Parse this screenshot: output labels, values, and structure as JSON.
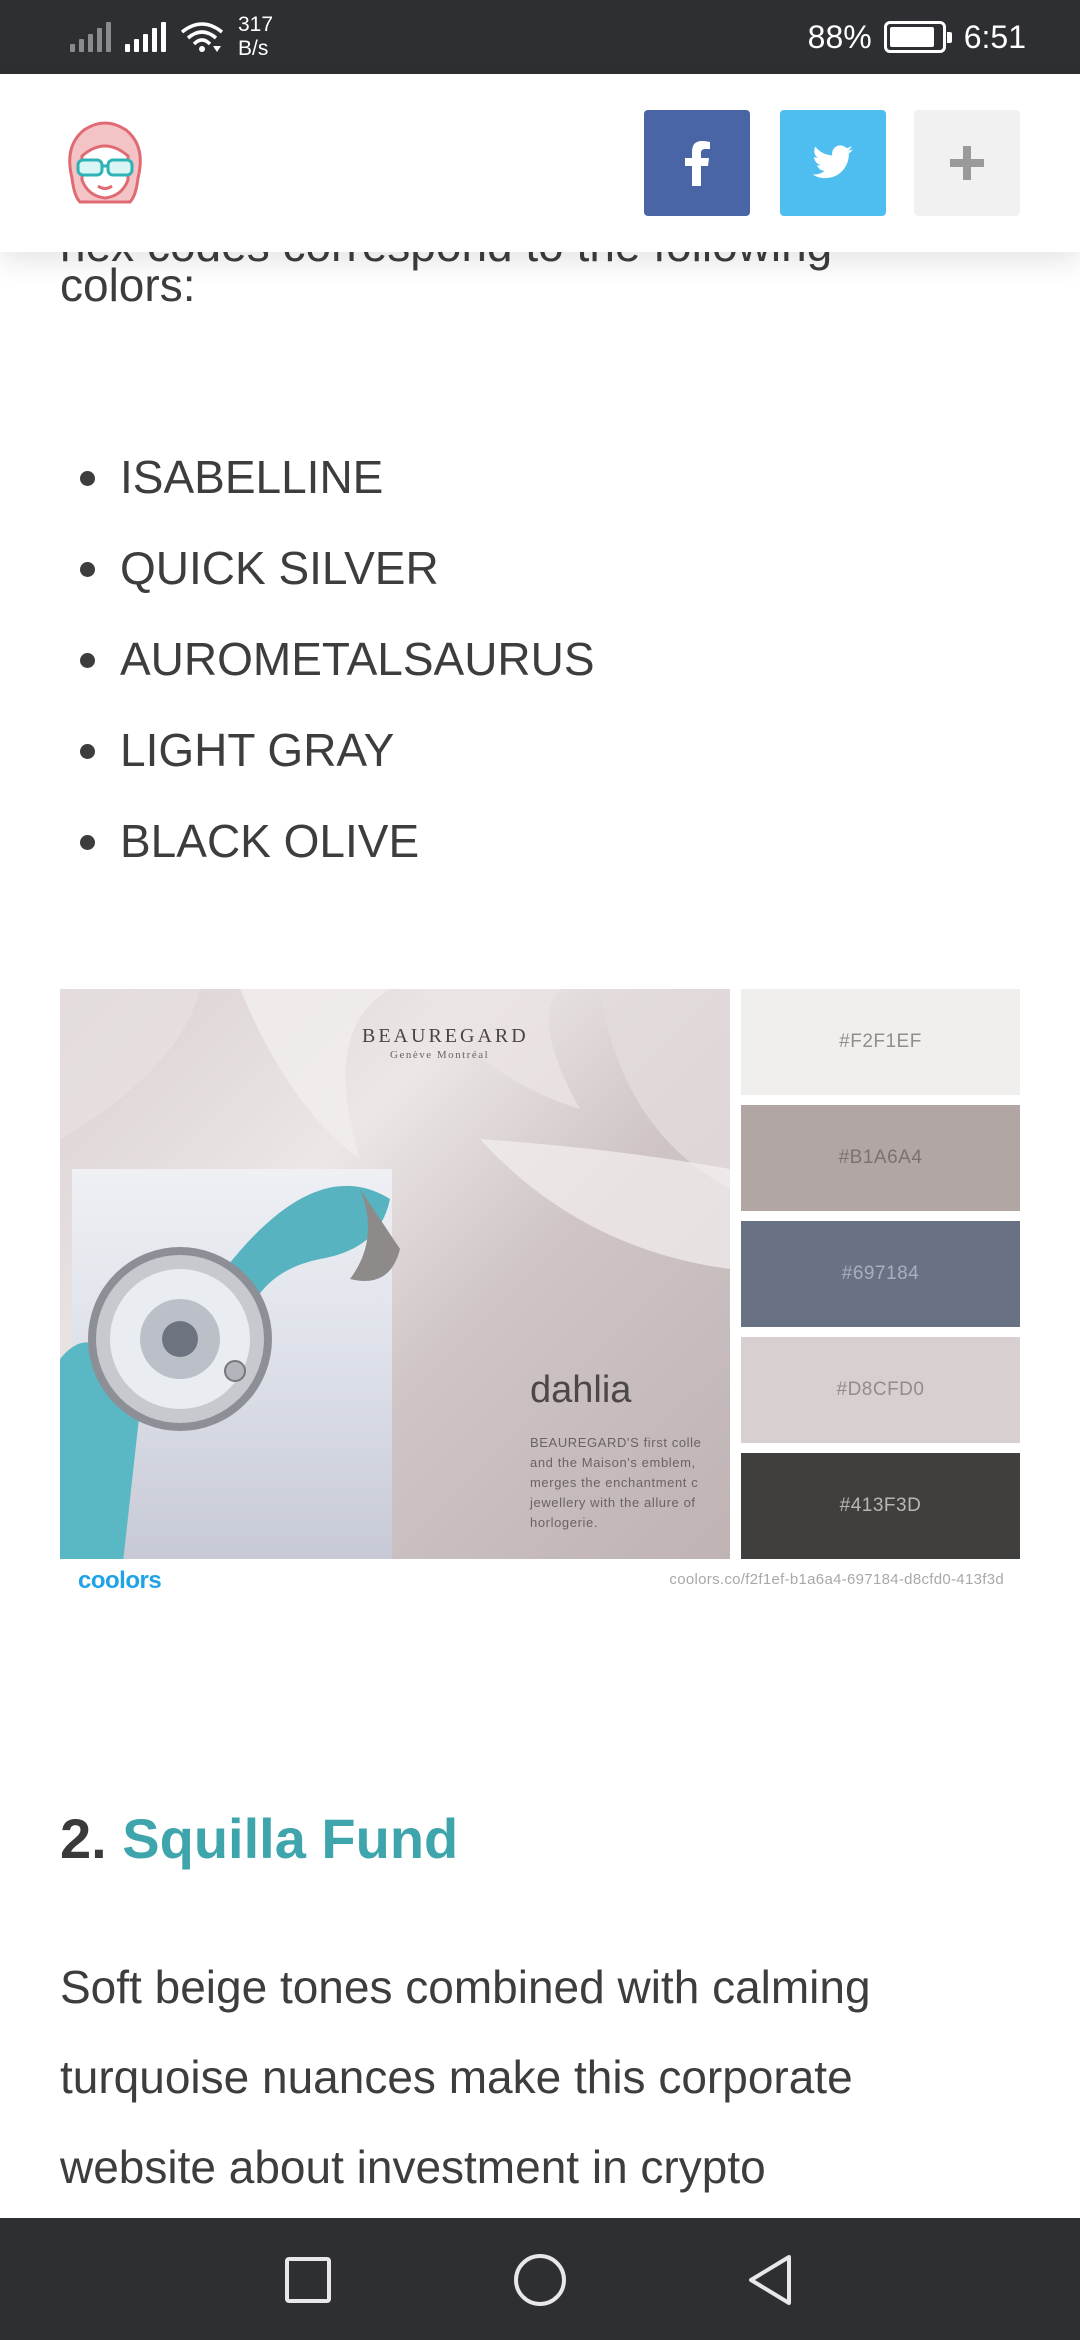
{
  "status_bar": {
    "net_speed_value": "317",
    "net_speed_unit": "B/s",
    "battery": "88%",
    "battery_level": 0.88,
    "time": "6:51"
  },
  "header": {
    "logo_icon": "girl-with-glasses-logo-icon",
    "share": {
      "facebook_icon": "facebook-icon",
      "twitter_icon": "twitter-icon",
      "more_icon": "plus-icon"
    }
  },
  "article": {
    "partial_line": "hex codes correspond to the following",
    "intro_end": "colors:",
    "color_names": [
      "ISABELLINE",
      "QUICK SILVER",
      "AUROMETALSAURUS",
      "LIGHT GRAY",
      "BLACK OLIVE"
    ],
    "palette": {
      "brand_title": "BEAUREGARD",
      "brand_subtitle": "Genève Montréal",
      "product_name": "dahlia",
      "product_copy": [
        "BEAUREGARD'S first colle",
        "and the Maison's emblem,",
        "merges the enchantment c",
        "jewellery with the allure of",
        "horlogerie."
      ],
      "swatches": [
        {
          "hex": "#F2F1EF",
          "color": "#f0efed",
          "text_color": "#8f8f8f"
        },
        {
          "hex": "#B1A6A4",
          "color": "#b1a6a4",
          "text_color": "#7b716f"
        },
        {
          "hex": "#697184",
          "color": "#697184",
          "text_color": "#a9afbd"
        },
        {
          "hex": "#D8CFD0",
          "color": "#d8cfd0",
          "text_color": "#958b8c"
        },
        {
          "hex": "#413F3D",
          "color": "#413f3d",
          "text_color": "#b9b7b5"
        }
      ],
      "coolors_logo": "coolors",
      "coolors_url": "coolors.co/f2f1ef-b1a6a4-697184-d8cfd0-413f3d"
    },
    "section": {
      "number": "2.",
      "title": "Squilla Fund"
    },
    "section_paragraph_lines": [
      "Soft beige tones combined with calming",
      "turquoise nuances make this corporate",
      "website about investment in crypto"
    ]
  },
  "nav_bar": {
    "recents_icon": "square-recents-icon",
    "home_icon": "circle-home-icon",
    "back_icon": "triangle-back-icon"
  }
}
